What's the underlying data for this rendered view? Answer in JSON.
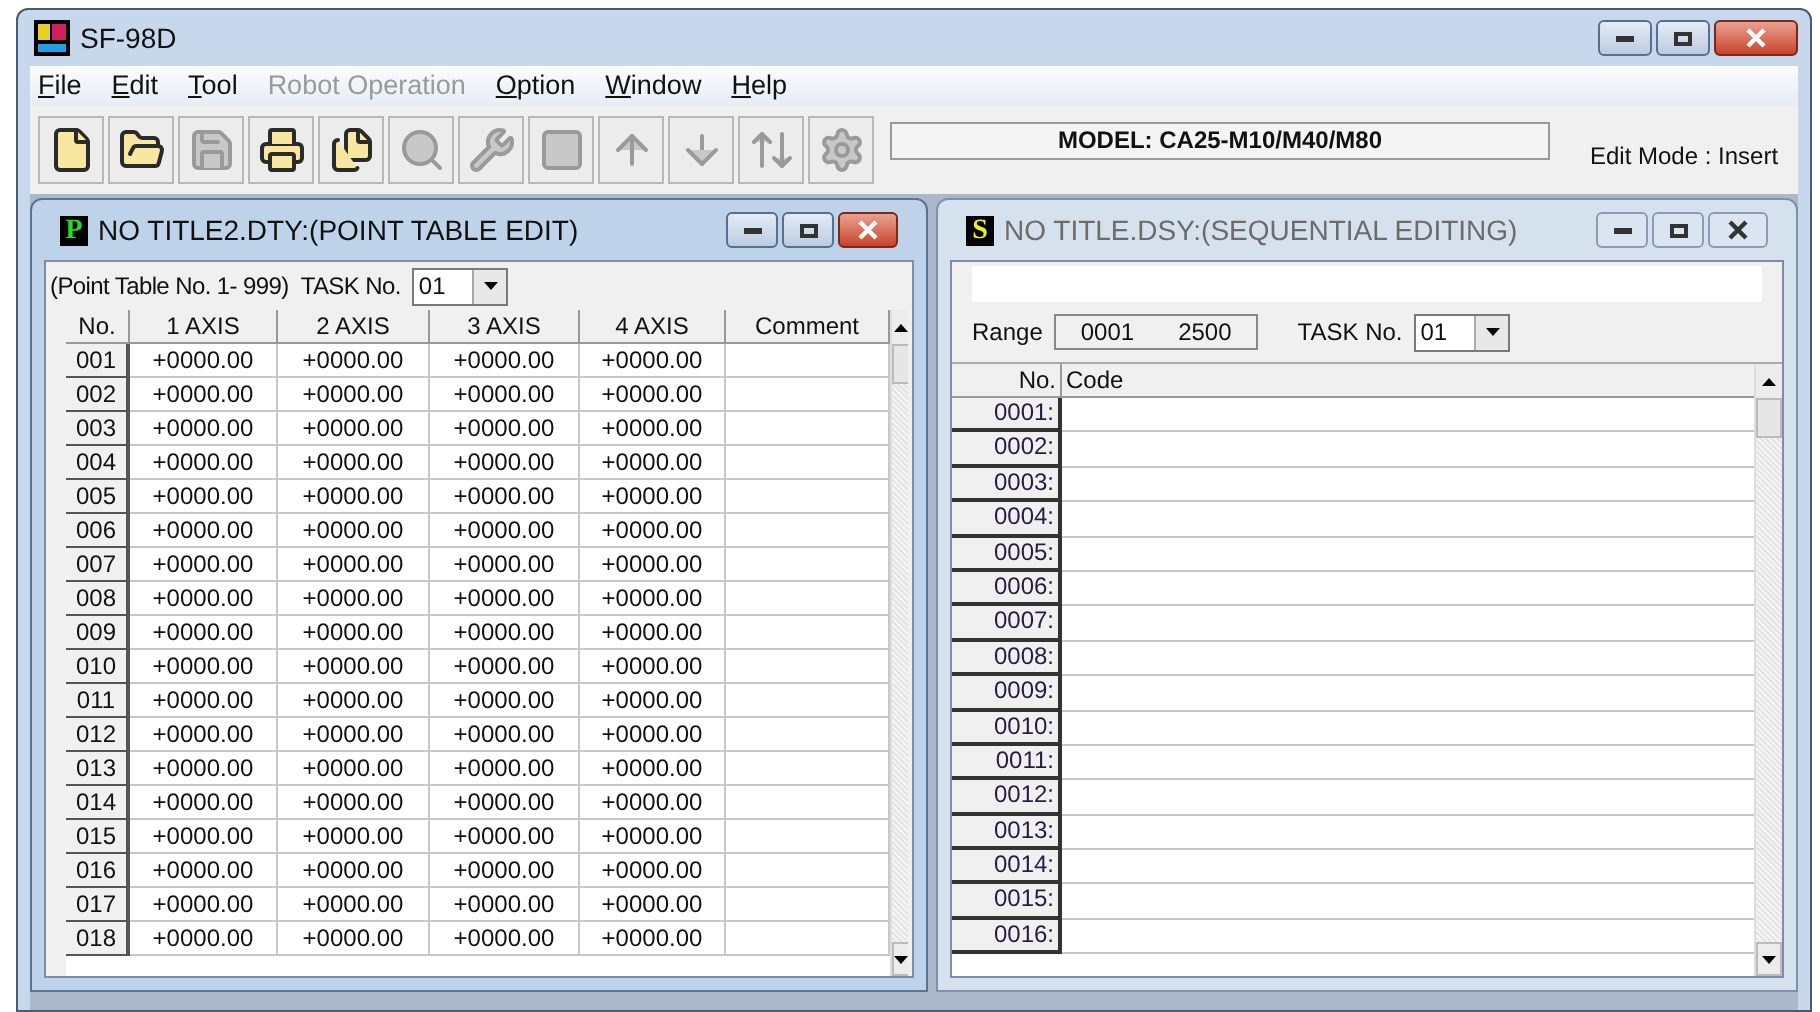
{
  "window": {
    "title": "SF-98D"
  },
  "menu": [
    {
      "label": "File",
      "disabled": false
    },
    {
      "label": "Edit",
      "disabled": false
    },
    {
      "label": "Tool",
      "disabled": false
    },
    {
      "label": "Robot Operation",
      "disabled": true
    },
    {
      "label": "Option",
      "disabled": false
    },
    {
      "label": "Window",
      "disabled": false
    },
    {
      "label": "Help",
      "disabled": false
    }
  ],
  "toolbar": [
    {
      "disabled": false
    },
    {
      "disabled": false
    },
    {
      "disabled": true
    },
    {
      "disabled": false
    },
    {
      "disabled": false
    },
    {
      "disabled": true
    },
    {
      "disabled": true
    },
    {
      "disabled": true
    },
    {
      "disabled": true
    },
    {
      "disabled": true
    },
    {
      "disabled": true
    },
    {
      "disabled": true
    }
  ],
  "model": "MODEL: CA25-M10/M40/M80",
  "edit_mode": "Edit Mode : Insert",
  "point_table": {
    "title": "NO TITLE2.DTY:(POINT TABLE EDIT)",
    "badge": "P",
    "active": true,
    "range_note": "(Point Table No. 1- 999)",
    "task_label": "TASK No.",
    "task_value": "01",
    "columns": [
      "No.",
      "1 AXIS",
      "2 AXIS",
      "3 AXIS",
      "4 AXIS",
      "Comment"
    ],
    "rows": [
      [
        "001",
        "+0000.00",
        "+0000.00",
        "+0000.00",
        "+0000.00"
      ],
      [
        "002",
        "+0000.00",
        "+0000.00",
        "+0000.00",
        "+0000.00"
      ],
      [
        "003",
        "+0000.00",
        "+0000.00",
        "+0000.00",
        "+0000.00"
      ],
      [
        "004",
        "+0000.00",
        "+0000.00",
        "+0000.00",
        "+0000.00"
      ],
      [
        "005",
        "+0000.00",
        "+0000.00",
        "+0000.00",
        "+0000.00"
      ],
      [
        "006",
        "+0000.00",
        "+0000.00",
        "+0000.00",
        "+0000.00"
      ],
      [
        "007",
        "+0000.00",
        "+0000.00",
        "+0000.00",
        "+0000.00"
      ],
      [
        "008",
        "+0000.00",
        "+0000.00",
        "+0000.00",
        "+0000.00"
      ],
      [
        "009",
        "+0000.00",
        "+0000.00",
        "+0000.00",
        "+0000.00"
      ],
      [
        "010",
        "+0000.00",
        "+0000.00",
        "+0000.00",
        "+0000.00"
      ],
      [
        "011",
        "+0000.00",
        "+0000.00",
        "+0000.00",
        "+0000.00"
      ],
      [
        "012",
        "+0000.00",
        "+0000.00",
        "+0000.00",
        "+0000.00"
      ],
      [
        "013",
        "+0000.00",
        "+0000.00",
        "+0000.00",
        "+0000.00"
      ],
      [
        "014",
        "+0000.00",
        "+0000.00",
        "+0000.00",
        "+0000.00"
      ],
      [
        "015",
        "+0000.00",
        "+0000.00",
        "+0000.00",
        "+0000.00"
      ],
      [
        "016",
        "+0000.00",
        "+0000.00",
        "+0000.00",
        "+0000.00"
      ],
      [
        "017",
        "+0000.00",
        "+0000.00",
        "+0000.00",
        "+0000.00"
      ],
      [
        "018",
        "+0000.00",
        "+0000.00",
        "+0000.00",
        "+0000.00"
      ]
    ]
  },
  "sequence": {
    "title": "NO TITLE.DSY:(SEQUENTIAL EDITING)",
    "badge": "S",
    "active": false,
    "range_label": "Range",
    "range_start": "0001",
    "range_end": "2500",
    "task_label": "TASK No.",
    "task_value": "01",
    "columns": [
      "No.",
      "Code"
    ],
    "rows": [
      "0001:",
      "0002:",
      "0003:",
      "0004:",
      "0005:",
      "0006:",
      "0007:",
      "0008:",
      "0009:",
      "0010:",
      "0011:",
      "0012:",
      "0013:",
      "0014:",
      "0015:",
      "0016:"
    ]
  }
}
